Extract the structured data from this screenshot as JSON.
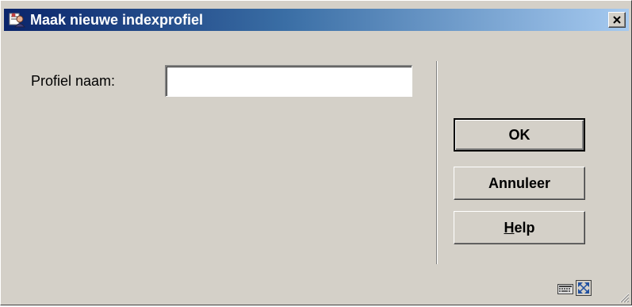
{
  "window": {
    "title": "Maak nieuwe indexprofiel"
  },
  "form": {
    "profile_name_label": "Profiel naam:",
    "profile_name_value": "",
    "profile_name_placeholder": ""
  },
  "buttons": {
    "ok_label": "OK",
    "cancel_label": "Annuleer",
    "help_first_letter": "H",
    "help_rest": "elp"
  },
  "icons": {
    "app": "app-user-icon",
    "close": "close-icon",
    "keyboard": "keyboard-icon",
    "resize": "resize-window-icon",
    "grip": "size-grip-icon"
  },
  "colors": {
    "titlebar_start": "#0a246a",
    "titlebar_end": "#a6caf0",
    "window_face": "#d4d0c8"
  }
}
